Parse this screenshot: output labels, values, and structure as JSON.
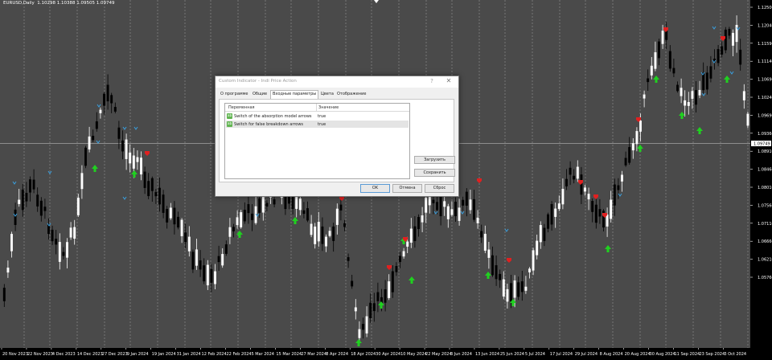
{
  "chart": {
    "title": "EURUSD,Daily  1.10298 1.10388 1.09505 1.09749",
    "price_labels": [
      "1.12500",
      "1.12040",
      "1.11590",
      "1.11140",
      "1.10690",
      "1.10240",
      "1.09690",
      "1.09360",
      "1.08910",
      "1.08460",
      "1.08010",
      "1.07560",
      "1.07110",
      "1.06660",
      "1.06210",
      "1.05760"
    ],
    "current_price": "1.09749",
    "date_labels": [
      "20 Nov 2023",
      "22 Nov 2023",
      "4 Dec 2023",
      "14 Dec 2023",
      "27 Dec 2023",
      "9 Jan 2024",
      "19 Jan 2024",
      "31 Jan 2024",
      "12 Feb 2024",
      "22 Feb 2024",
      "5 Mar 2024",
      "15 Mar 2024",
      "27 Mar 2024",
      "8 Apr 2024",
      "18 Apr 2024",
      "30 Apr 2024",
      "10 May 2024",
      "22 May 2024",
      "3 Jun 2024",
      "13 Jun 2024",
      "25 Jun 2024",
      "5 Jul 2024",
      "17 Jul 2024",
      "29 Jul 2024",
      "8 Aug 2024",
      "20 Aug 2024",
      "30 Aug 2024",
      "11 Sep 2024",
      "23 Sep 2024",
      "3 Oct 2024"
    ],
    "colors": {
      "background": "#4a4a4a",
      "bull_candle": "#ffffff",
      "bear_candle": "#000000",
      "grid": "#d0d0d0",
      "up_arrow": "#20d020",
      "down_arrow": "#e02020",
      "absorption_marker": "#3aa0e0",
      "price_scale_bg": "#000000",
      "price_label_bg": "#ffffff"
    }
  },
  "dialog": {
    "title": "Custom Indicator - Indi Price Action",
    "help": "?",
    "close": "✕",
    "tabs": [
      "О программе",
      "Общие",
      "Входные параметры",
      "Цвета",
      "Отображение"
    ],
    "active_tab": "Входные параметры",
    "table": {
      "col_name": "Переменная",
      "col_value": "Значение",
      "rows": [
        {
          "name": "Switch of the absorption model arrows",
          "value": "true"
        },
        {
          "name": "Switch for false breakdown arrows",
          "value": "true"
        }
      ]
    },
    "load_button": "Загрузить",
    "save_button": "Сохранить",
    "ok_button": "OK",
    "cancel_button": "Отмена",
    "reset_button": "Сброс"
  }
}
